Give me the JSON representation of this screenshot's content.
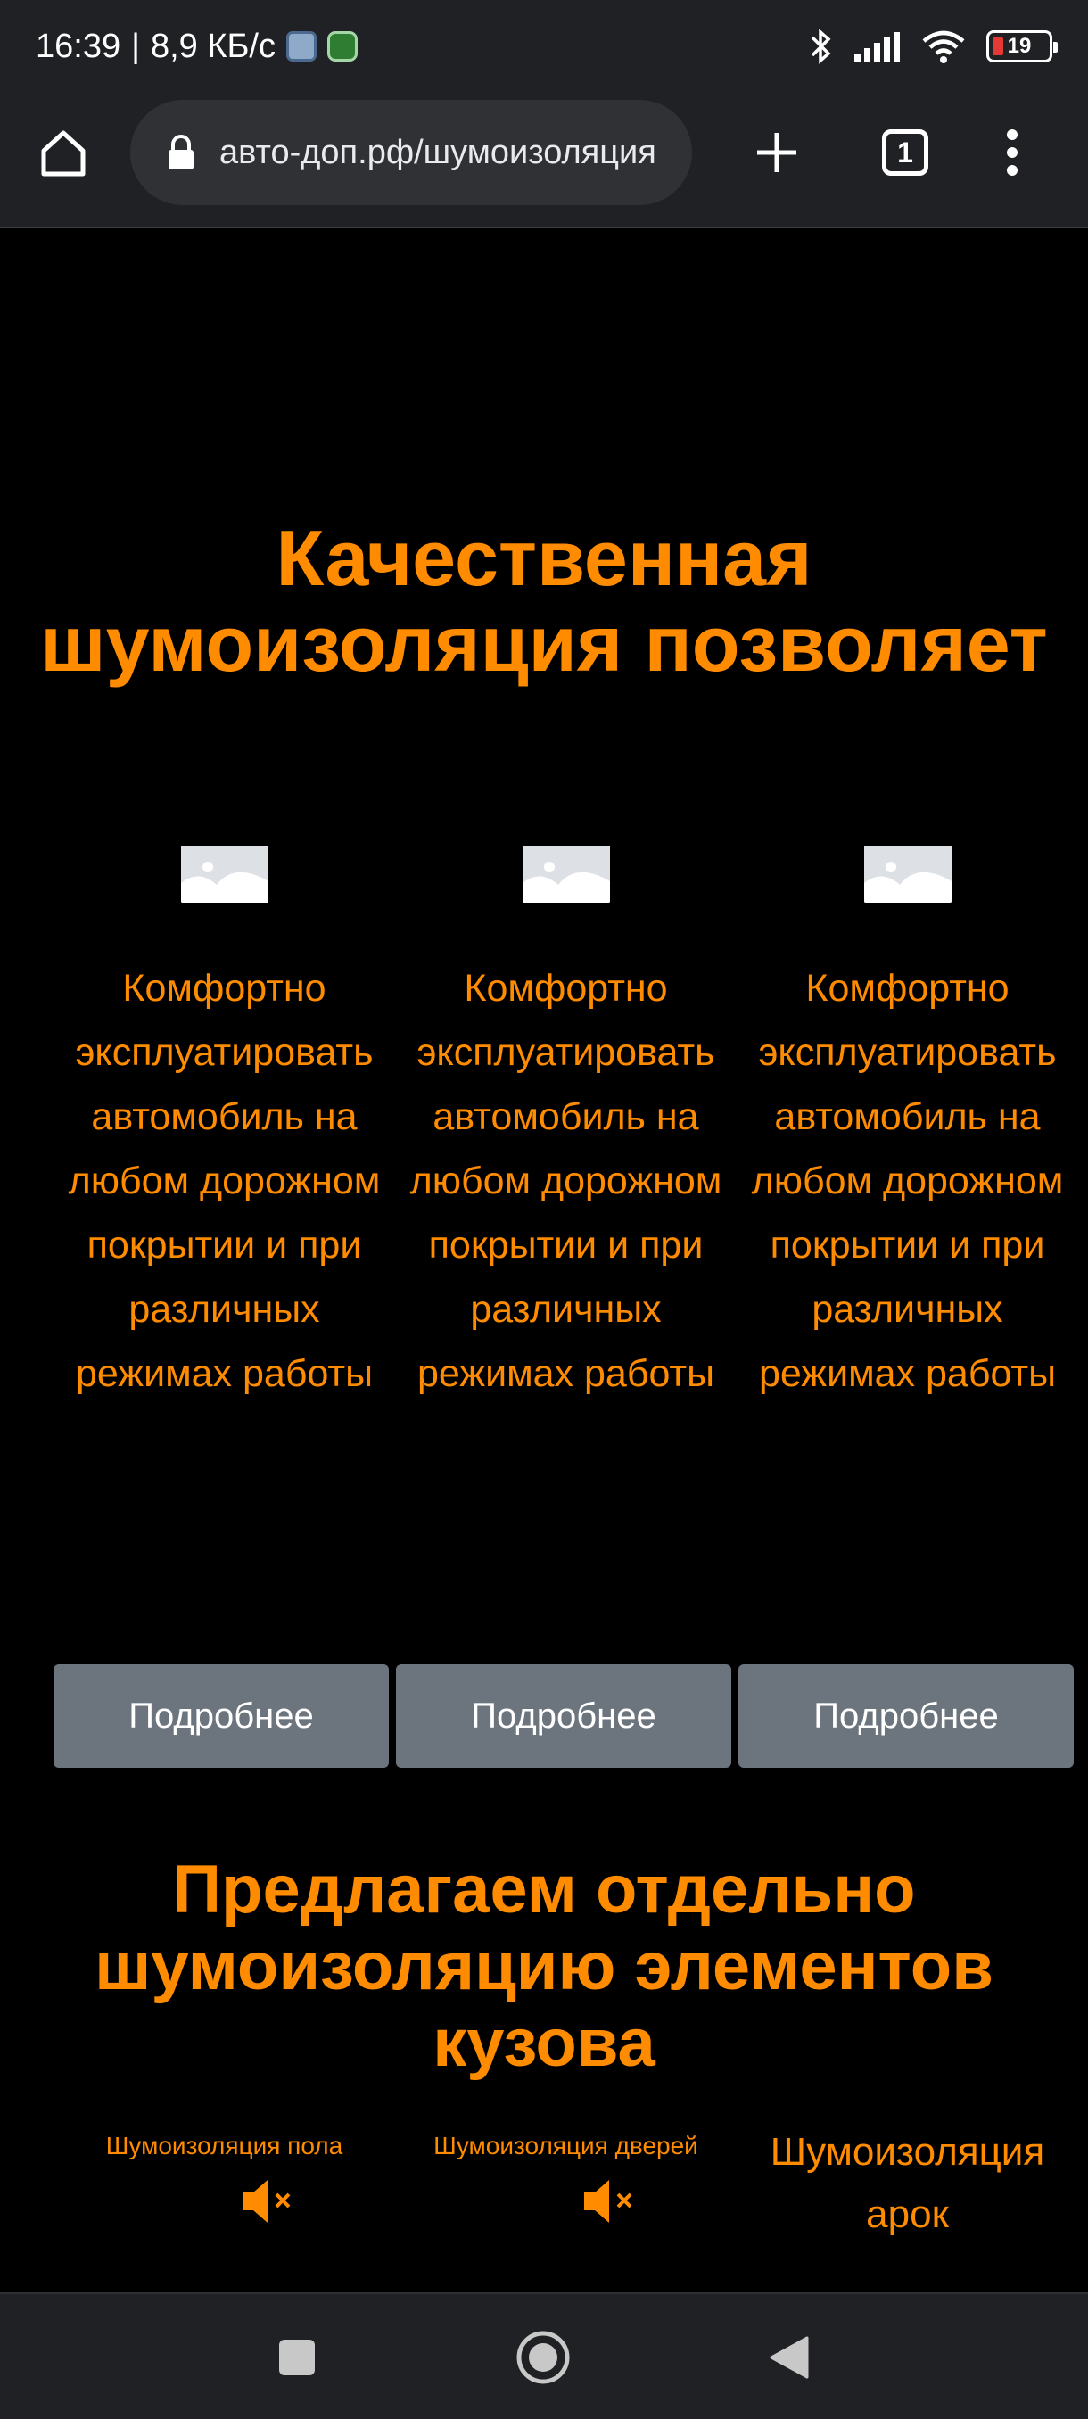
{
  "status_bar": {
    "time": "16:39",
    "separator": "|",
    "net_speed": "8,9 КБ/с",
    "app_icons": [
      "notes-app-icon",
      "security-app-icon"
    ],
    "right_icons": [
      "bluetooth-icon",
      "signal-icon",
      "wifi-icon"
    ],
    "battery_level": "19"
  },
  "browser": {
    "url": "авто-доп.рф/шумоизоляция",
    "tab_count": "1",
    "icons": [
      "home-icon",
      "lock-icon",
      "new-tab-icon",
      "tab-switcher-icon",
      "menu-icon"
    ]
  },
  "page": {
    "main_heading": "Качественная шумоизоляция позволяет",
    "features": [
      {
        "icon": "image-placeholder-icon",
        "text": "Комфортно эксплуатировать автомобиль на любом дорожном покрытии и при различных режимах работы"
      },
      {
        "icon": "image-placeholder-icon",
        "text": "Комфортно эксплуатировать автомобиль на любом дорожном покрытии и при различных режимах работы"
      },
      {
        "icon": "image-placeholder-icon",
        "text": "Комфортно эксплуатировать автомобиль на любом дорожном покрытии и при различных режимах работы"
      }
    ],
    "more_buttons": [
      "Подробнее",
      "Подробнее",
      "Подробнее"
    ],
    "offer_heading": "Предлагаем отдельно шумоизоляцию элементов кузова",
    "elements": [
      {
        "title": "Шумоизоляция пола",
        "icon": "muted-speaker-icon"
      },
      {
        "title": "Шумоизоляция дверей",
        "icon": "muted-speaker-icon"
      },
      {
        "title": "Шумоизоляция арок"
      }
    ]
  },
  "colors": {
    "accent": "#ff8c00",
    "button_bg": "#6c757d",
    "chrome_bg": "#202124",
    "page_bg": "#000000"
  },
  "nav_bar": {
    "icons": [
      "recents-square-icon",
      "home-circle-icon",
      "back-triangle-icon"
    ]
  }
}
